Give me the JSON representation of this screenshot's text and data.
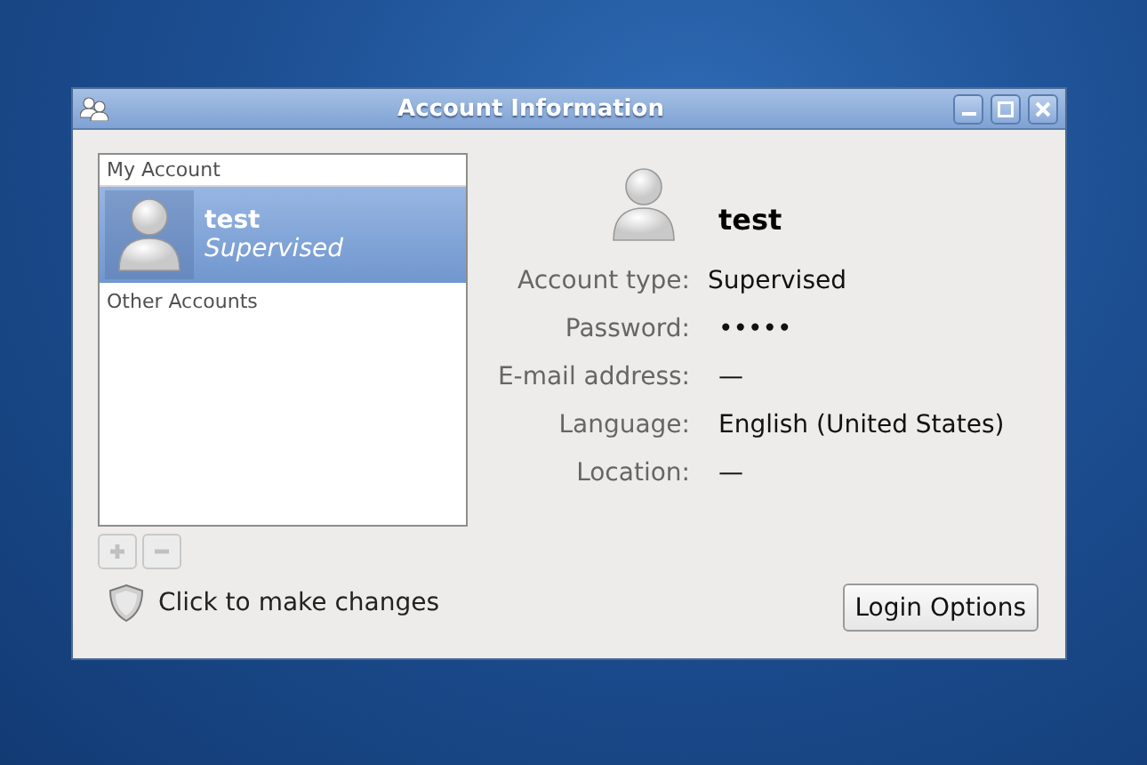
{
  "window": {
    "title": "Account Information"
  },
  "accounts": {
    "sections": [
      {
        "header": "My Account",
        "users": [
          {
            "name": "test",
            "type": "Supervised",
            "selected": true
          }
        ]
      },
      {
        "header": "Other Accounts"
      }
    ],
    "add_button": {
      "disabled": true
    },
    "remove_button": {
      "disabled": true
    }
  },
  "lock": {
    "text": "Click to make changes"
  },
  "details": {
    "name": "test",
    "fields": [
      {
        "label": "Account type:",
        "value": "Supervised"
      },
      {
        "label": "Password:",
        "value": "•••••"
      },
      {
        "label": "E-mail address:",
        "value": "—"
      },
      {
        "label": "Language:",
        "value": "English (United States)"
      },
      {
        "label": "Location:",
        "value": "—"
      }
    ]
  },
  "buttons": [
    "Login Options"
  ]
}
